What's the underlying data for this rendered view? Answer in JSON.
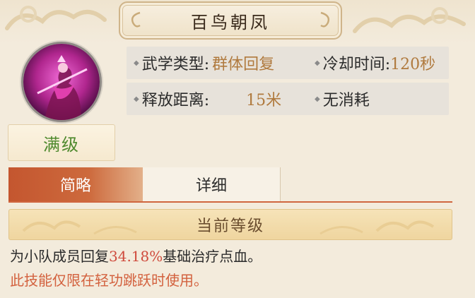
{
  "skill": {
    "name": "百鸟朝凤",
    "level_status": "满级"
  },
  "info": {
    "type_label": "武学类型:",
    "type_value": "群体回复",
    "cooldown_label": "冷却时间:",
    "cooldown_value": "120秒",
    "range_label": "释放距离:",
    "range_value": "15米",
    "cost_label": "无消耗"
  },
  "tabs": [
    {
      "label": "简略",
      "active": true
    },
    {
      "label": "详细",
      "active": false
    }
  ],
  "current_level": {
    "title": "当前等级",
    "desc_prefix": "为小队成员回复",
    "desc_value": "34.18%",
    "desc_suffix": "基础治疗点血。",
    "note": "此技能仅限在轻功跳跃时使用。"
  },
  "colors": {
    "accent": "#c4562f",
    "value": "#b07a3e",
    "highlight": "#cf4a3c",
    "level_green": "#4f8a2e"
  }
}
